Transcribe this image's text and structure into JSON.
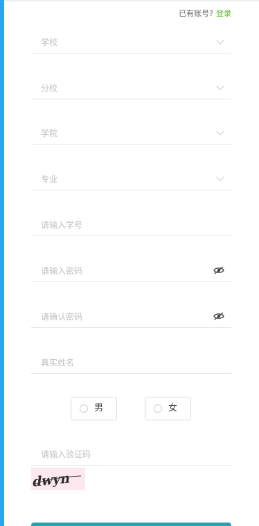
{
  "header": {
    "has_account": "已有账号?",
    "login_link": "登录"
  },
  "form": {
    "school": "学校",
    "branch": "分校",
    "college": "学院",
    "major": "专业",
    "student_id_placeholder": "请输入学号",
    "password_placeholder": "请输入密码",
    "confirm_password_placeholder": "请确认密码",
    "real_name_placeholder": "真实姓名",
    "gender": {
      "male": "男",
      "female": "女"
    },
    "captcha_placeholder": "请输入验证码",
    "captcha_text": "dwyn"
  },
  "colors": {
    "accent_bar": "#2aa6ee",
    "link_green": "#5fb832",
    "submit_button": "#2c9fb0"
  },
  "icons": {
    "dropdown": "chevron-down-icon",
    "password_toggle": "eye-icon",
    "radio": "radio-icon"
  }
}
